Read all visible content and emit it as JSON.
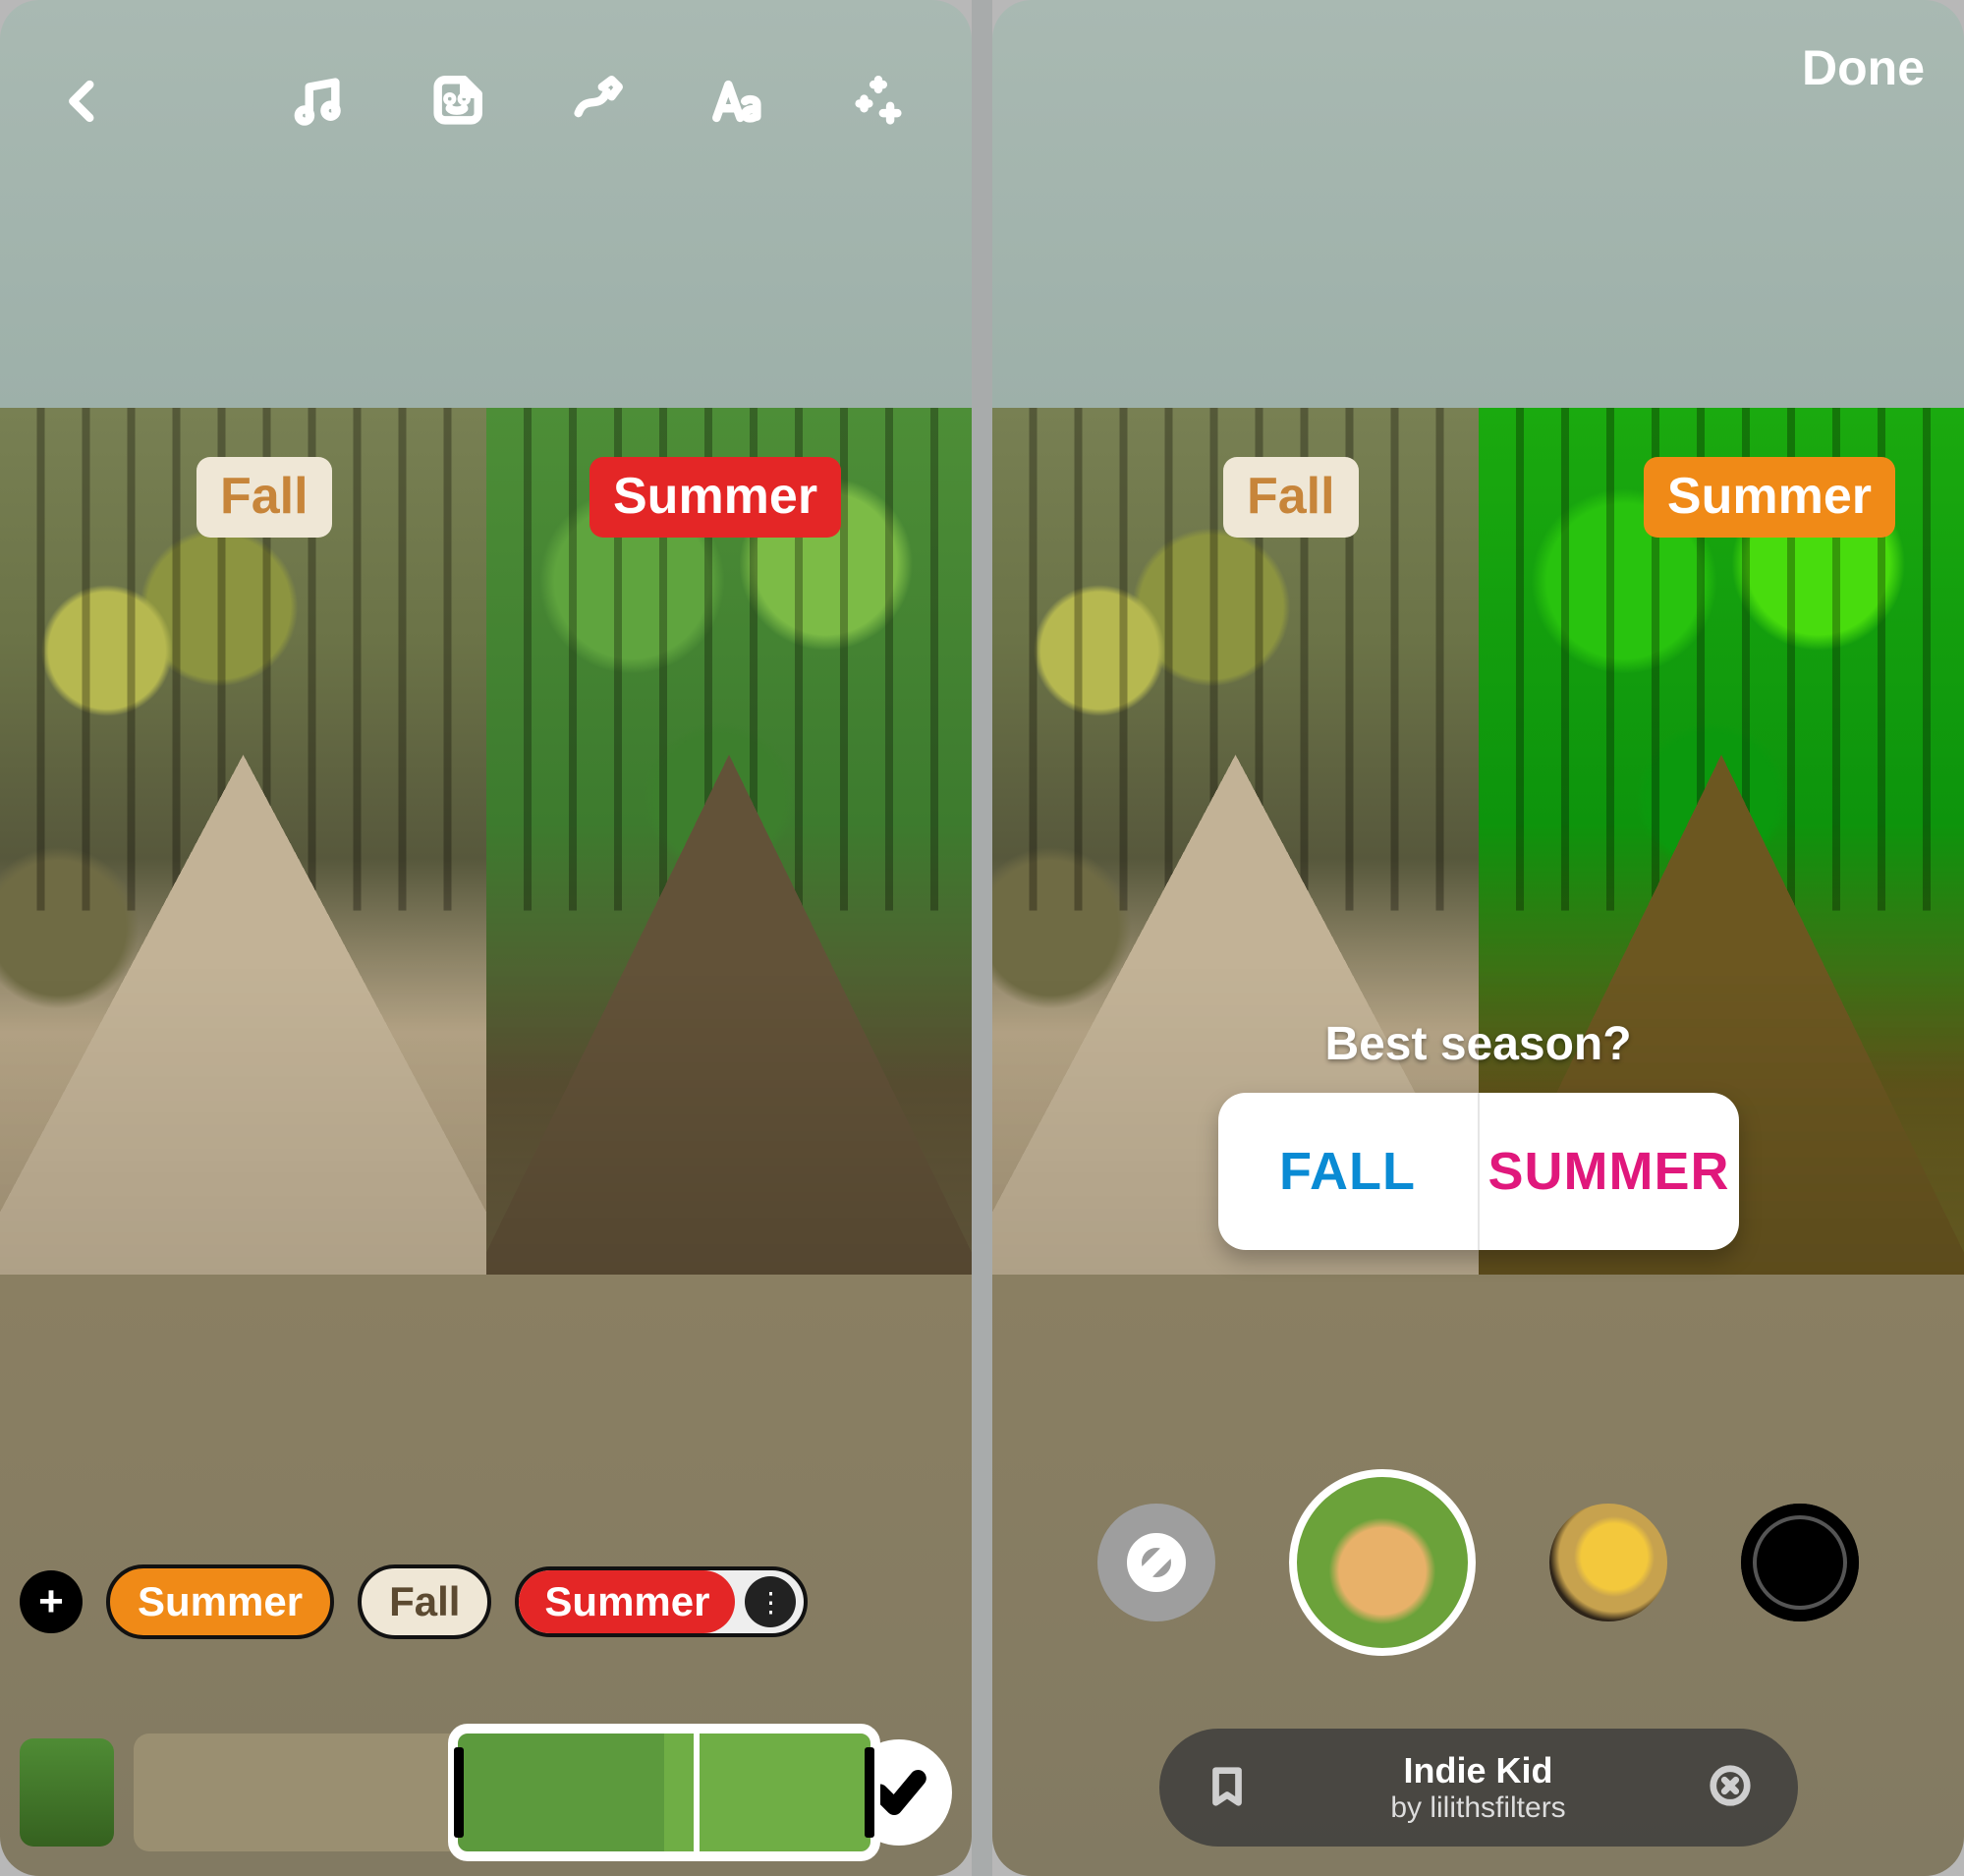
{
  "left": {
    "labels": {
      "fall": "Fall",
      "summer": "Summer"
    },
    "tagstrip": {
      "pill_orange": "Summer",
      "pill_cream": "Fall",
      "pill_red": "Summer"
    }
  },
  "right": {
    "done": "Done",
    "labels": {
      "fall": "Fall",
      "summer": "Summer"
    },
    "poll": {
      "question": "Best season?",
      "opt1": "FALL",
      "opt2": "SUMMER"
    },
    "filter_name": "Indie Kid",
    "filter_by": "by lilithsfilters"
  }
}
